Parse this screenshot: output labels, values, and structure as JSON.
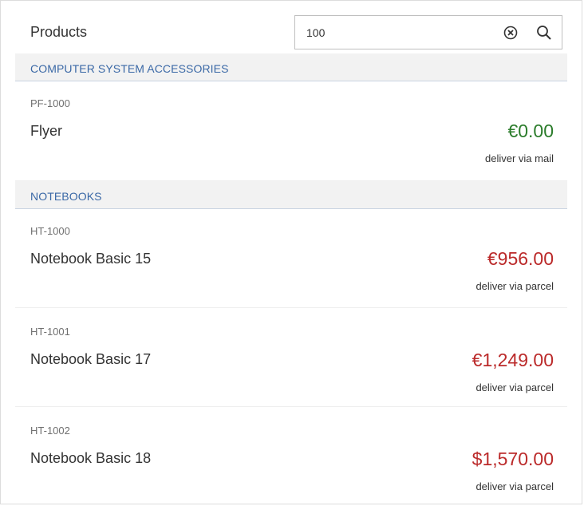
{
  "header": {
    "title": "Products",
    "search_value": "100",
    "search_placeholder": ""
  },
  "groups": [
    {
      "label": "COMPUTER SYSTEM ACCESSORIES",
      "items": [
        {
          "id": "PF-1000",
          "name": "Flyer",
          "price": "€0.00",
          "price_status": "green",
          "note": "deliver via mail"
        }
      ]
    },
    {
      "label": "NOTEBOOKS",
      "items": [
        {
          "id": "HT-1000",
          "name": "Notebook Basic 15",
          "price": "€956.00",
          "price_status": "red",
          "note": "deliver via parcel"
        },
        {
          "id": "HT-1001",
          "name": "Notebook Basic 17",
          "price": "€1,249.00",
          "price_status": "red",
          "note": "deliver via parcel"
        },
        {
          "id": "HT-1002",
          "name": "Notebook Basic 18",
          "price": "$1,570.00",
          "price_status": "red",
          "note": "deliver via parcel"
        }
      ]
    }
  ],
  "icons": {
    "clear": "clear-icon",
    "search": "search-icon"
  },
  "colors": {
    "group_label": "#3a68a6",
    "price_positive": "#2b7c2b",
    "price_negative": "#bb2a2a"
  }
}
